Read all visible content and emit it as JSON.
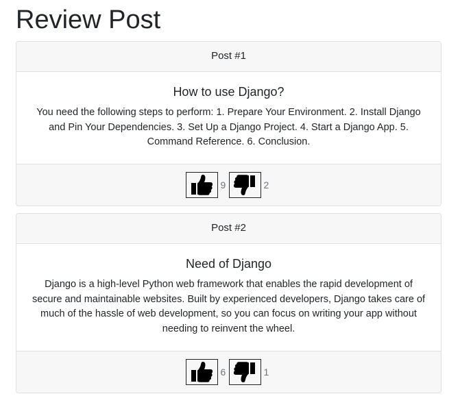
{
  "page": {
    "title": "Review Post"
  },
  "posts": [
    {
      "header": "Post #1",
      "title": "How to use Django?",
      "text": "You need the following steps to perform: 1. Prepare Your Environment. 2. Install Django and Pin Your Dependencies. 3. Set Up a Django Project. 4. Start a Django App. 5. Command Reference. 6. Conclusion.",
      "likes": "9",
      "dislikes": "2"
    },
    {
      "header": "Post #2",
      "title": "Need of Django",
      "text": "Django is a high-level Python web framework that enables the rapid development of secure and maintainable websites. Built by experienced developers, Django takes care of much of the hassle of web development, so you can focus on writing your app without needing to reinvent the wheel.",
      "likes": "6",
      "dislikes": "1"
    }
  ],
  "icons": {
    "like": "thumbs-up-icon",
    "dislike": "thumbs-down-icon"
  },
  "colors": {
    "text": "#212529",
    "card_header_bg": "#f7f7f7",
    "border": "#dfdfdf",
    "count": "#6c757d"
  }
}
